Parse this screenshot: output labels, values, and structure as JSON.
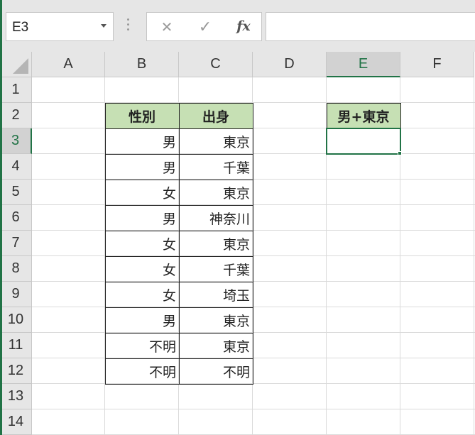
{
  "name_box": {
    "value": "E3"
  },
  "formula_bar": {
    "cancel_glyph": "✕",
    "enter_glyph": "✓",
    "fx_label": "fx",
    "content": ""
  },
  "columns": [
    "A",
    "B",
    "C",
    "D",
    "E",
    "F"
  ],
  "rows": [
    "1",
    "2",
    "3",
    "4",
    "5",
    "6",
    "7",
    "8",
    "9",
    "10",
    "11",
    "12",
    "13",
    "14"
  ],
  "selected_cell": {
    "column": "E",
    "row": "3"
  },
  "table": {
    "headers": {
      "gender": "性別",
      "origin": "出身"
    },
    "records": [
      {
        "gender": "男",
        "origin": "東京"
      },
      {
        "gender": "男",
        "origin": "千葉"
      },
      {
        "gender": "女",
        "origin": "東京"
      },
      {
        "gender": "男",
        "origin": "神奈川"
      },
      {
        "gender": "女",
        "origin": "東京"
      },
      {
        "gender": "女",
        "origin": "千葉"
      },
      {
        "gender": "女",
        "origin": "埼玉"
      },
      {
        "gender": "男",
        "origin": "東京"
      },
      {
        "gender": "不明",
        "origin": "東京"
      },
      {
        "gender": "不明",
        "origin": "不明"
      }
    ]
  },
  "criteria_header": "男+東京",
  "colors": {
    "accent": "#217346",
    "header_fill": "#c6e0b4"
  }
}
